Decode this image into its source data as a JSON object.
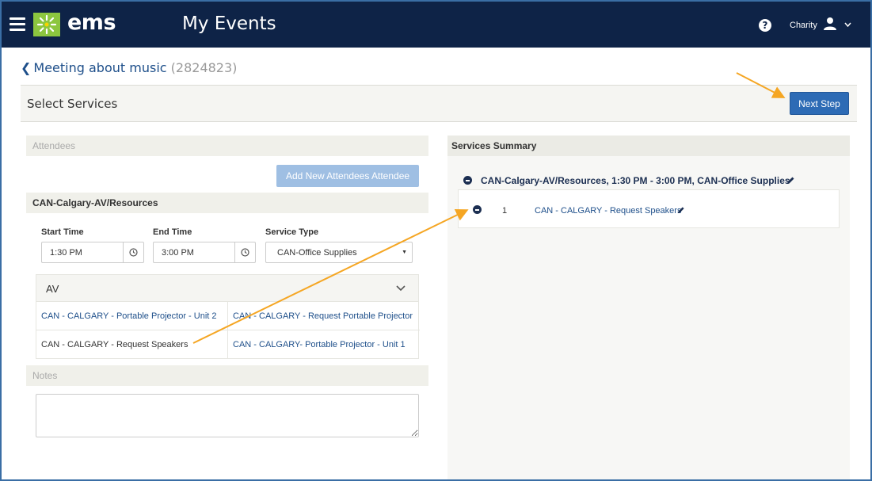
{
  "header": {
    "logo_text": "ems",
    "title": "My Events",
    "help_glyph": "?",
    "user_name": "Charity",
    "icons": [
      "hamburger-menu-icon",
      "ems-logo-icon",
      "help-icon",
      "user-icon",
      "chevron-down-icon"
    ]
  },
  "breadcrumb": {
    "event_name": "Meeting about music",
    "event_id": "(2824823)"
  },
  "page": {
    "title": "Select Services",
    "next_button": "Next Step"
  },
  "attendees": {
    "heading": "Attendees",
    "add_button": "Add New Attendees Attendee"
  },
  "resource": {
    "heading": "CAN-Calgary-AV/Resources",
    "start_time_label": "Start Time",
    "start_time": "1:30 PM",
    "end_time_label": "End Time",
    "end_time": "3:00 PM",
    "service_type_label": "Service Type",
    "service_type": "CAN-Office Supplies",
    "category": "AV",
    "items": [
      "CAN - CALGARY - Portable Projector - Unit 2",
      "CAN - CALGARY - Request Portable Projector",
      "CAN - CALGARY - Request Speakers",
      "CAN - CALGARY- Portable Projector - Unit 1"
    ]
  },
  "notes": {
    "heading": "Notes",
    "value": ""
  },
  "summary": {
    "heading": "Services Summary",
    "group_title": "CAN-Calgary-AV/Resources, 1:30 PM - 3:00 PM, CAN-Office Supplies",
    "rows": [
      {
        "quantity": "1",
        "name": "CAN - CALGARY - Request Speakers"
      }
    ]
  },
  "colors": {
    "topbar": "#0e2347",
    "logo_green": "#8cc63f",
    "primary_button": "#2d6bb5",
    "link": "#1e4f8a",
    "annotation_arrow": "#f5a623"
  }
}
